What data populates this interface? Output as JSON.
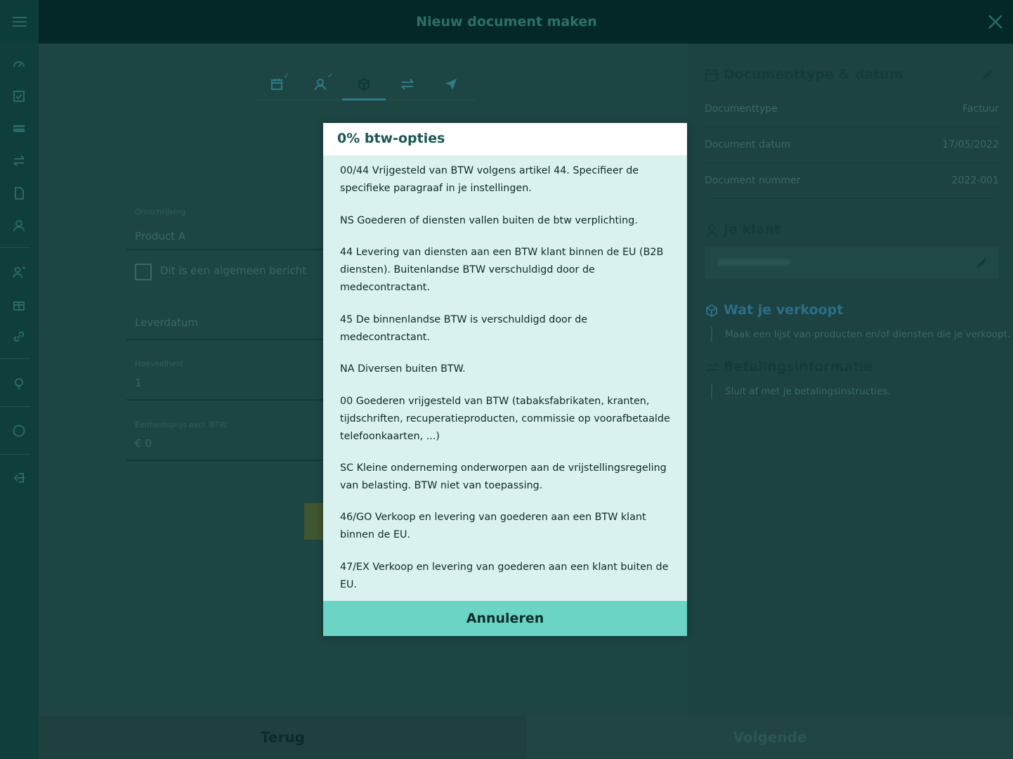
{
  "window": {
    "title": "Nieuw document maken"
  },
  "form": {
    "description_label": "Omschrijving",
    "description_value": "Product A",
    "checkbox_label": "Dit is een algemeen bericht",
    "delivery_date_label": "Leverdatum",
    "quantity_label": "Hoeveelheid",
    "quantity_value": "1",
    "unit_price_label": "Eenheidsprijs excl. BTW",
    "unit_price_value": "€ 0"
  },
  "right_panel": {
    "doc_section_title": "Documenttype & datum",
    "rows": [
      {
        "label": "Documenttype",
        "value": "Factuur"
      },
      {
        "label": "Document datum",
        "value": "17/05/2022"
      },
      {
        "label": "Document nummer",
        "value": "2022-001"
      }
    ],
    "client_section_title": "Je klant",
    "sales_section_title": "Wat je verkoopt",
    "sales_description": "Maak een lijst van producten en/of diensten die je verkoopt.",
    "payment_section_title": "Betalingsinformatie",
    "payment_description": "Sluit af met je betalingsinstructies."
  },
  "bottom": {
    "back_label": "Terug",
    "next_label": "Volgende"
  },
  "modal": {
    "title": "0% btw-opties",
    "options": [
      "00/44 Vrijgesteld van BTW volgens artikel 44. Specifieer de specifieke paragraaf in je instellingen.",
      "NS Goederen of diensten vallen buiten de btw verplichting.",
      "44 Levering van diensten aan een BTW klant binnen de EU (B2B diensten). Buitenlandse BTW verschuldigd door de medecontractant.",
      "45 De binnenlandse BTW is verschuldigd door de medecontractant.",
      "NA Diversen buiten BTW.",
      "00 Goederen vrijgesteld van BTW (tabaksfabrikaten, kranten, tijdschriften, recuperatieproducten, commissie op voorafbetaalde telefoonkaarten, ...)",
      "SC Kleine onderneming onderworpen aan de vrijstellingsregeling van belasting. BTW niet van toepassing.",
      "46/GO Verkoop en levering van goederen aan een BTW klant binnen de EU.",
      "47/EX Verkoop en levering van goederen aan een klant buiten de EU."
    ],
    "cancel_label": "Annuleren"
  },
  "colors": {
    "modal_bg": "#daf2ef",
    "cancel_button": "#6cd4c5",
    "title_text": "#1d5653"
  }
}
